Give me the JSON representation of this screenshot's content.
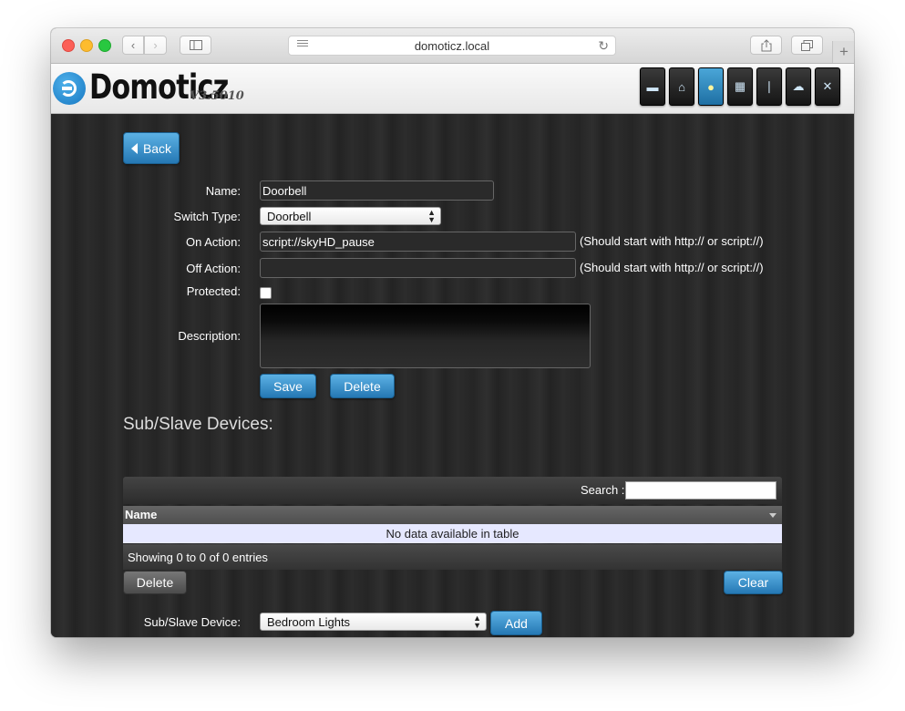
{
  "browser": {
    "url": "domoticz.local"
  },
  "app": {
    "logo_text": "Domoticz",
    "version": "V3.5010",
    "nav_icons": [
      "dashboard-icon",
      "floorplan-icon",
      "lightbulb-icon",
      "scenes-icon",
      "temperature-icon",
      "weather-icon",
      "utility-tools-icon"
    ],
    "active_nav": "lightbulb-icon",
    "accent_color": "#2f86c2"
  },
  "form": {
    "back_label": "Back",
    "name_label": "Name:",
    "name_value": "Doorbell",
    "switch_type_label": "Switch Type:",
    "switch_type_value": "Doorbell",
    "on_action_label": "On Action:",
    "on_action_value": "script://skyHD_pause",
    "on_action_hint": "(Should start with http:// or script://)",
    "off_action_label": "Off Action:",
    "off_action_value": "",
    "off_action_hint": "(Should start with http:// or script://)",
    "protected_label": "Protected:",
    "protected_checked": false,
    "description_label": "Description:",
    "description_value": "",
    "save_label": "Save",
    "delete_label": "Delete"
  },
  "sub_devices": {
    "title": "Sub/Slave Devices:",
    "search_label": "Search :",
    "search_value": "",
    "column_name": "Name",
    "empty_text": "No data available in table",
    "info_text": "Showing 0 to 0 of 0 entries",
    "delete_label": "Delete",
    "clear_label": "Clear",
    "device_label": "Sub/Slave Device:",
    "device_value": "Bedroom Lights",
    "add_label": "Add"
  }
}
